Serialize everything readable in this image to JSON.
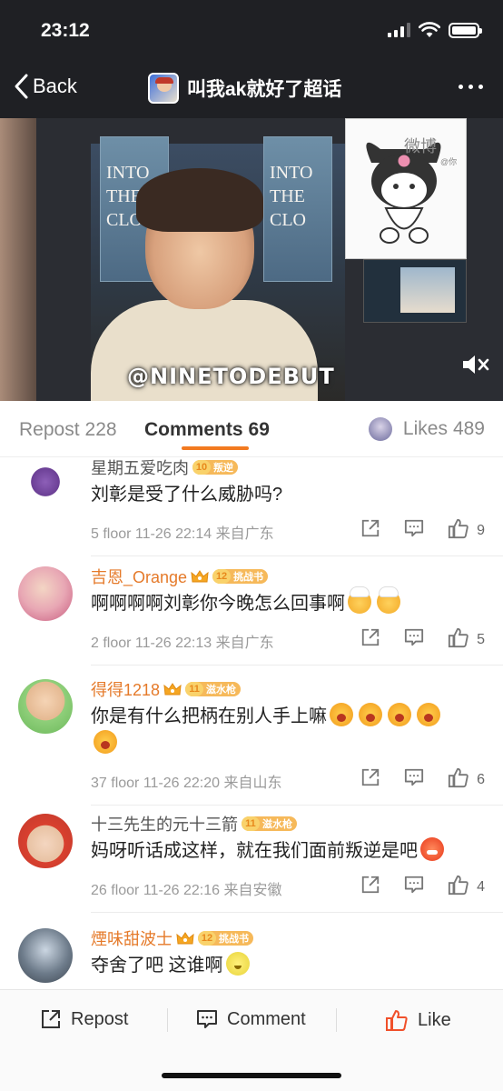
{
  "status_bar": {
    "time": "23:12"
  },
  "nav": {
    "back_label": "Back",
    "title": "叫我ak就好了超话"
  },
  "video": {
    "watermark": "@NINETODEBUT",
    "poster_left": "INTO\nTHE\nCLOUDS",
    "poster_right": "INTO\nTHE\nCLO",
    "pip_text": "微博",
    "pip_sub": "@你"
  },
  "tabs": {
    "repost": {
      "label": "Repost",
      "count": "228"
    },
    "comments": {
      "label": "Comments",
      "count": "69"
    },
    "likes": {
      "label": "Likes",
      "count": "489"
    }
  },
  "comments": [
    {
      "username": "星期五爱吃肉",
      "username_style": "gray",
      "crown": false,
      "level": "10",
      "badge": "叛逆",
      "text": "刘彰是受了什么威胁吗?",
      "emojis": [],
      "floor": "5 floor",
      "time": "11-26 22:14",
      "location": "来自广东",
      "likes": "9"
    },
    {
      "username": "吉恩_Orange",
      "username_style": "orange",
      "crown": true,
      "level": "12",
      "badge": "挑战书",
      "text": "啊啊啊啊刘彰你今晚怎么回事啊",
      "emojis": [
        "shy",
        "shy"
      ],
      "floor": "2 floor",
      "time": "11-26 22:13",
      "location": "来自广东",
      "likes": "5"
    },
    {
      "username": "得得1218",
      "username_style": "orange",
      "crown": true,
      "level": "11",
      "badge": "滋水枪",
      "text": "你是有什么把柄在别人手上嘛",
      "emojis": [
        "cry",
        "cry",
        "cry",
        "cry",
        "cry"
      ],
      "floor": "37 floor",
      "time": "11-26 22:20",
      "location": "来自山东",
      "likes": "6"
    },
    {
      "username": "十三先生的元十三箭",
      "username_style": "gray",
      "crown": false,
      "level": "11",
      "badge": "滋水枪",
      "text": "妈呀听话成这样，就在我们面前叛逆是吧",
      "emojis": [
        "angry"
      ],
      "floor": "26 floor",
      "time": "11-26 22:16",
      "location": "来自安徽",
      "likes": "4"
    },
    {
      "username": "煙味甜波士",
      "username_style": "orange",
      "crown": true,
      "level": "12",
      "badge": "挑战书",
      "text": "夺舍了吧 这谁啊",
      "emojis": [
        "lemon"
      ]
    }
  ],
  "bottom_bar": {
    "repost": "Repost",
    "comment": "Comment",
    "like": "Like"
  },
  "colors": {
    "accent": "#f27a20",
    "username_orange": "#e57a2a",
    "like_orange": "#f0502a"
  },
  "icons": [
    "back-chevron-icon",
    "more-icon",
    "mute-icon",
    "share-icon",
    "comment-icon",
    "thumb-up-icon",
    "crown-icon"
  ]
}
